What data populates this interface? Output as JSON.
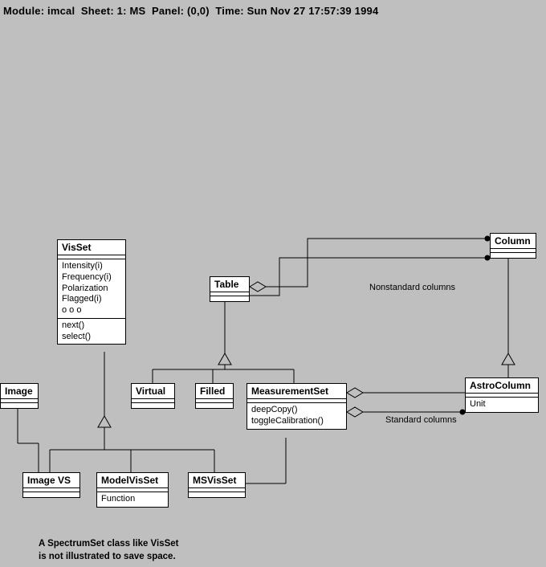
{
  "header": {
    "module_label": "Module:",
    "module": "imcal",
    "sheet_label": "Sheet:",
    "sheet": "1: MS",
    "panel_label": "Panel:",
    "panel": "(0,0)",
    "time_label": "Time:",
    "time": "Sun Nov 27 17:57:39 1994"
  },
  "classes": {
    "visset": {
      "name": "VisSet",
      "attrs": "Intensity(i)\nFrequency(i)\nPolarization\nFlagged(i)\no o o",
      "ops": "next()\nselect()"
    },
    "table": {
      "name": "Table"
    },
    "column": {
      "name": "Column"
    },
    "virtual": {
      "name": "Virtual"
    },
    "filled": {
      "name": "Filled"
    },
    "measurementset": {
      "name": "MeasurementSet",
      "ops": "deepCopy()\ntoggleCalibration()"
    },
    "astrocolumn": {
      "name": "AstroColumn",
      "attrs": "Unit"
    },
    "image": {
      "name": "Image"
    },
    "imagevs": {
      "name": "Image VS"
    },
    "modelvisset": {
      "name": "ModelVisSet",
      "attrs": "Function"
    },
    "msvisset": {
      "name": "MSVisSet"
    }
  },
  "labels": {
    "nonstd": "Nonstandard columns",
    "std": "Standard columns"
  },
  "note": {
    "line1": "A SpectrumSet class like VisSet",
    "line2": "is not illustrated to save space."
  }
}
